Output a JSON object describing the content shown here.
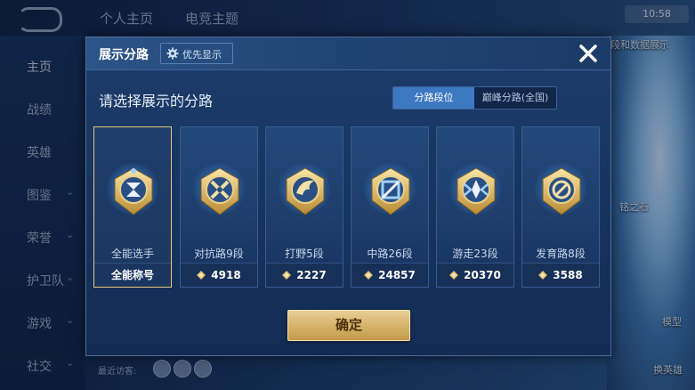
{
  "background": {
    "tabs": [
      "个人主页",
      "电竞主题"
    ],
    "sidebar": [
      {
        "label": "主页",
        "active": true,
        "chev": false
      },
      {
        "label": "战绩",
        "active": false,
        "chev": false
      },
      {
        "label": "英雄",
        "active": false,
        "chev": false
      },
      {
        "label": "图鉴",
        "active": false,
        "chev": true
      },
      {
        "label": "荣誉",
        "active": false,
        "chev": true
      },
      {
        "label": "护卫队",
        "active": false,
        "chev": true
      },
      {
        "label": "游戏",
        "active": false,
        "chev": true
      },
      {
        "label": "社交",
        "active": false,
        "chev": true
      }
    ],
    "right_labels": [
      "段和数据展示",
      "铭之石",
      "模型",
      "换英雄"
    ],
    "visitors_label": "最近访客:",
    "top_right_text": "10:58"
  },
  "modal": {
    "title": "展示分路",
    "priority_label": "优先显示",
    "subtitle": "请选择展示的分路",
    "tabs": [
      {
        "label": "分路段位",
        "active": true
      },
      {
        "label": "巅峰分路(全国)",
        "active": false
      }
    ],
    "confirm_label": "确定",
    "colors": {
      "accent": "#3d78c1",
      "gold": "#d6b46b",
      "selected_border": "#e8c57a"
    },
    "cards": [
      {
        "name": "全能选手",
        "value": "全能称号",
        "icon": "all-round-badge-icon",
        "selected": true,
        "show_diamond": false
      },
      {
        "name": "对抗路9段",
        "value": "4918",
        "icon": "clash-lane-badge-icon",
        "selected": false,
        "show_diamond": true
      },
      {
        "name": "打野5段",
        "value": "2227",
        "icon": "jungle-badge-icon",
        "selected": false,
        "show_diamond": true
      },
      {
        "name": "中路26段",
        "value": "24857",
        "icon": "mid-lane-badge-icon",
        "selected": false,
        "show_diamond": true
      },
      {
        "name": "游走23段",
        "value": "20370",
        "icon": "roam-badge-icon",
        "selected": false,
        "show_diamond": true
      },
      {
        "name": "发育路8段",
        "value": "3588",
        "icon": "farm-lane-badge-icon",
        "selected": false,
        "show_diamond": true
      }
    ]
  }
}
